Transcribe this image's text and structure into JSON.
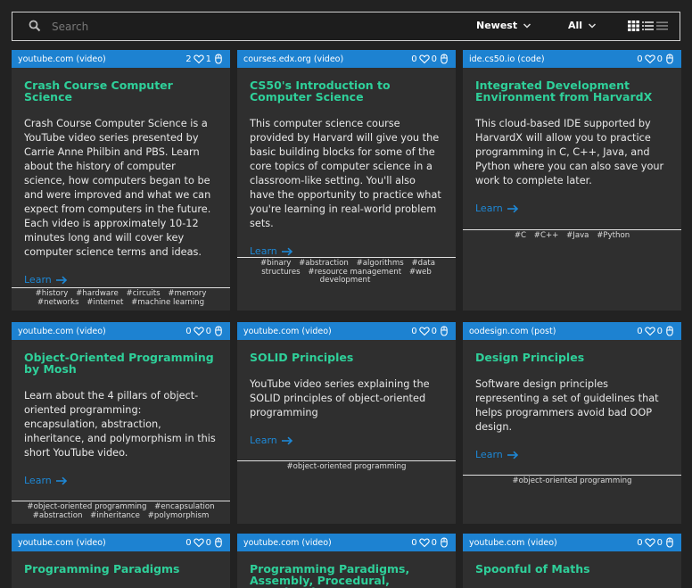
{
  "search": {
    "placeholder": "Search"
  },
  "sort": {
    "label": "Newest"
  },
  "filter": {
    "label": "All"
  },
  "cards": [
    {
      "source": "youtube.com (video)",
      "likes": "2",
      "clicks": "1",
      "title": "Crash Course Computer Science",
      "description": "Crash Course Computer Science is a YouTube video series presented by Carrie Anne Philbin and PBS. Learn about the history of computer science, how computers began to be and were improved and what we can expect from computers in the future. Each video is approximately 10-12 minutes long and will cover key computer science terms and ideas.",
      "learn": "Learn",
      "tags": [
        "#history",
        "#hardware",
        "#circuits",
        "#memory",
        "#networks",
        "#internet",
        "#machine learning"
      ]
    },
    {
      "source": "courses.edx.org (video)",
      "likes": "0",
      "clicks": "0",
      "title": "CS50's Introduction to Computer Science",
      "description": "This computer science course provided by Harvard will give you the basic building blocks for some of the core topics of computer science in a classroom-like setting. You'll also have the opportunity to practice what you're learning in real-world problem sets.",
      "learn": "Learn",
      "tags": [
        "#binary",
        "#abstraction",
        "#algorithms",
        "#data structures",
        "#resource management",
        "#web development"
      ]
    },
    {
      "source": "ide.cs50.io (code)",
      "likes": "0",
      "clicks": "0",
      "title": "Integrated Development Environment from HarvardX",
      "description": "This cloud-based IDE supported by HarvardX will allow you to practice programming in C, C++, Java, and Python where you can also save your work to complete later.",
      "learn": "Learn",
      "tags": [
        "#C",
        "#C++",
        "#Java",
        "#Python"
      ]
    },
    {
      "source": "youtube.com (video)",
      "likes": "0",
      "clicks": "0",
      "title": "Object-Oriented Programming by Mosh",
      "description": "Learn about the 4 pillars of object-oriented programming: encapsulation, abstraction, inheritance, and polymorphism in this short YouTube video.",
      "learn": "Learn",
      "tags": [
        "#object-oriented programming",
        "#encapsulation",
        "#abstraction",
        "#inheritance",
        "#polymorphism"
      ]
    },
    {
      "source": "youtube.com (video)",
      "likes": "0",
      "clicks": "0",
      "title": "SOLID Principles",
      "description": "YouTube video series explaining the SOLID principles of object-oriented programming",
      "learn": "Learn",
      "tags": [
        "#object-oriented programming"
      ]
    },
    {
      "source": "oodesign.com (post)",
      "likes": "0",
      "clicks": "0",
      "title": "Design Principles",
      "description": "Software design principles representing a set of guidelines that helps programmers avoid bad OOP design.",
      "learn": "Learn",
      "tags": [
        "#object-oriented programming"
      ]
    },
    {
      "source": "youtube.com (video)",
      "likes": "0",
      "clicks": "0",
      "title": "Programming Paradigms",
      "description": "",
      "learn": "",
      "tags": []
    },
    {
      "source": "youtube.com (video)",
      "likes": "0",
      "clicks": "0",
      "title": "Programming Paradigms, Assembly, Procedural, Functional",
      "description": "",
      "learn": "",
      "tags": []
    },
    {
      "source": "youtube.com (video)",
      "likes": "0",
      "clicks": "0",
      "title": "Spoonful of Maths",
      "description": "",
      "learn": "",
      "tags": []
    }
  ]
}
